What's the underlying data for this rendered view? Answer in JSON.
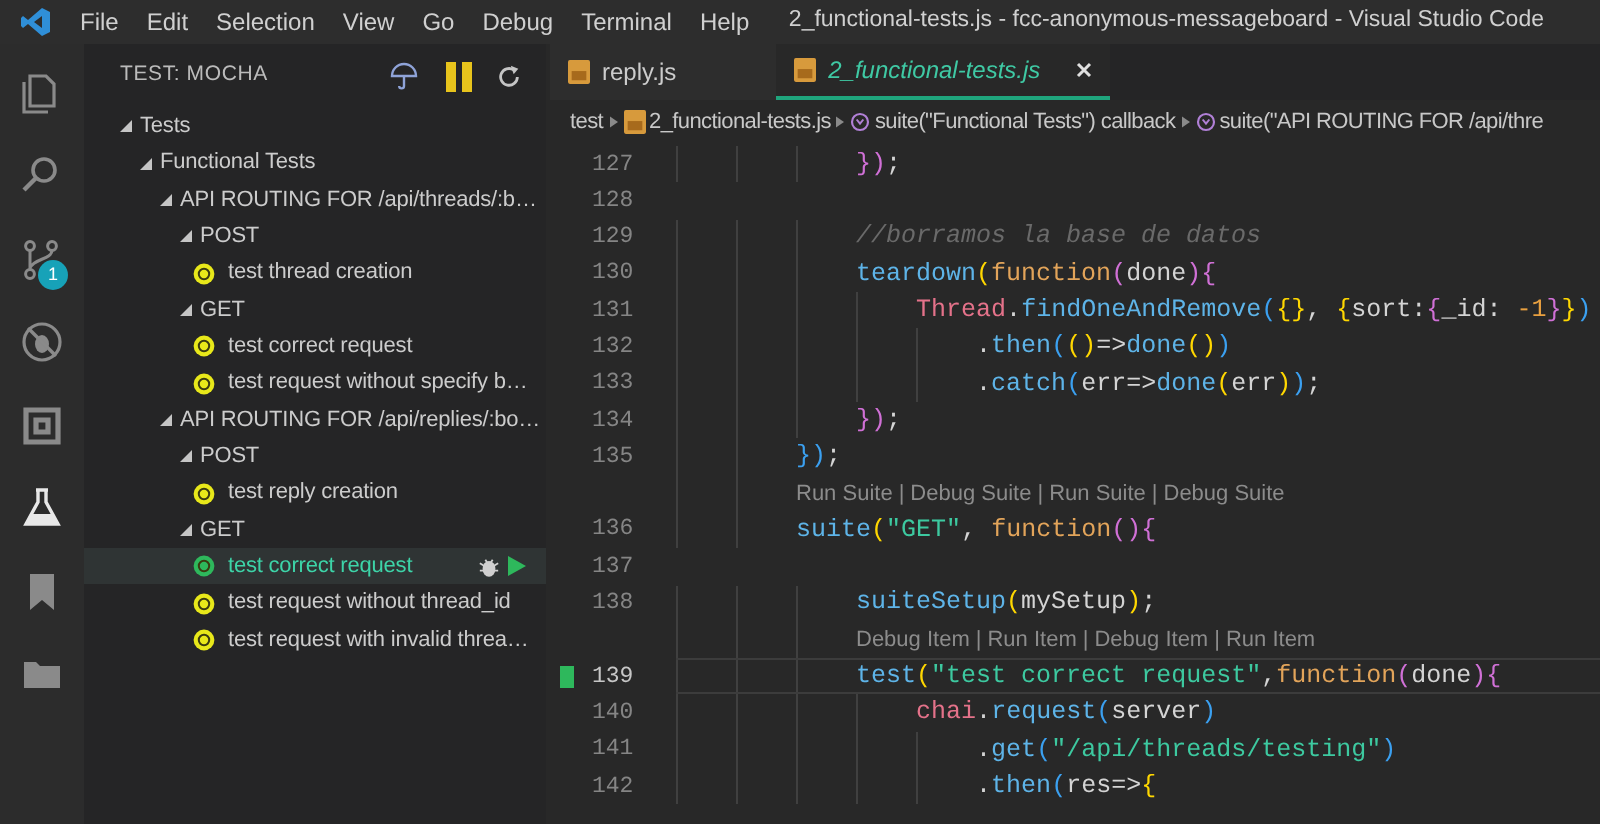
{
  "title_bar": {
    "menu": [
      "File",
      "Edit",
      "Selection",
      "View",
      "Go",
      "Debug",
      "Terminal",
      "Help"
    ],
    "title": "2_functional-tests.js - fcc-anonymous-messageboard - Visual Studio Code"
  },
  "activity_bar": [
    {
      "kind": "files",
      "selected": false
    },
    {
      "kind": "search",
      "selected": false
    },
    {
      "kind": "source-control",
      "selected": false,
      "badge": "1"
    },
    {
      "kind": "debug",
      "selected": false
    },
    {
      "kind": "extensions",
      "selected": false
    },
    {
      "kind": "test",
      "selected": true
    },
    {
      "kind": "bookmark",
      "selected": false
    },
    {
      "kind": "folder",
      "selected": false
    }
  ],
  "sidebar": {
    "title": "TEST: MOCHA",
    "tree": [
      {
        "kind": "suite",
        "label": "Tests",
        "expanded": true,
        "children": [
          {
            "kind": "suite",
            "label": "Functional Tests",
            "expanded": true,
            "children": [
              {
                "kind": "suite",
                "label": "API ROUTING FOR /api/threads/:b…",
                "expanded": true,
                "children": [
                  {
                    "kind": "suite",
                    "label": "POST",
                    "expanded": true,
                    "children": [
                      {
                        "kind": "pending",
                        "label": "test thread creation",
                        "selected": false
                      }
                    ]
                  },
                  {
                    "kind": "suite",
                    "label": "GET",
                    "expanded": true,
                    "children": [
                      {
                        "kind": "pending",
                        "label": "test correct request",
                        "selected": false
                      },
                      {
                        "kind": "pending",
                        "label": "test request without specify b…",
                        "selected": false
                      }
                    ]
                  }
                ]
              },
              {
                "kind": "suite",
                "label": "API ROUTING FOR /api/replies/:bo…",
                "expanded": true,
                "children": [
                  {
                    "kind": "suite",
                    "label": "POST",
                    "expanded": true,
                    "children": [
                      {
                        "kind": "pending",
                        "label": "test reply creation",
                        "selected": false
                      }
                    ]
                  },
                  {
                    "kind": "suite",
                    "label": "GET",
                    "expanded": true,
                    "children": [
                      {
                        "kind": "passed",
                        "label": "test correct request",
                        "selected": true
                      },
                      {
                        "kind": "pending",
                        "label": "test request without thread_id",
                        "selected": false
                      },
                      {
                        "kind": "pending",
                        "label": "test request with invalid threa…",
                        "selected": false
                      }
                    ]
                  }
                ]
              }
            ]
          }
        ]
      }
    ]
  },
  "tabs": [
    {
      "label": "reply.js",
      "selected": false
    },
    {
      "label": "2_functional-tests.js",
      "selected": true
    }
  ],
  "breadcrumb": [
    {
      "kind": "folder",
      "label": "test"
    },
    {
      "kind": "file",
      "label": "2_functional-tests.js"
    },
    {
      "kind": "symbol",
      "label": "suite(\"Functional Tests\") callback"
    },
    {
      "kind": "symbol",
      "label": "suite(\"API ROUTING FOR /api/thre"
    }
  ],
  "editor": {
    "lines": [
      {
        "kind": "code",
        "number": "127",
        "current": false,
        "passed": false,
        "tokens": [
          {
            "kind": "br2",
            "t": "            })"
          },
          {
            "kind": "txt",
            "t": ";"
          }
        ]
      },
      {
        "kind": "code",
        "number": "128",
        "current": false,
        "passed": false
      },
      {
        "kind": "code",
        "number": "129",
        "current": false,
        "passed": false,
        "tokens": [
          {
            "kind": "cmt",
            "t": "            //borramos la base de datos"
          }
        ]
      },
      {
        "kind": "code",
        "number": "130",
        "current": false,
        "passed": false,
        "tokens": [
          {
            "kind": "fn",
            "t": "            teardown"
          },
          {
            "kind": "br1",
            "t": "("
          },
          {
            "kind": "kw",
            "t": "function"
          },
          {
            "kind": "br2",
            "t": "("
          },
          {
            "kind": "txt",
            "t": "done"
          },
          {
            "kind": "br2",
            "t": "){"
          }
        ]
      },
      {
        "kind": "code",
        "number": "131",
        "current": false,
        "passed": false,
        "tokens": [
          {
            "kind": "var",
            "t": "                Thread"
          },
          {
            "kind": "txt",
            "t": "."
          },
          {
            "kind": "fn",
            "t": "findOneAndRemove"
          },
          {
            "kind": "br3",
            "t": "("
          },
          {
            "kind": "br1",
            "t": "{}"
          },
          {
            "kind": "txt",
            "t": ", "
          },
          {
            "kind": "br1",
            "t": "{"
          },
          {
            "kind": "txt",
            "t": "sort:"
          },
          {
            "kind": "br2",
            "t": "{"
          },
          {
            "kind": "txt",
            "t": "_id: "
          },
          {
            "kind": "num",
            "t": "-1"
          },
          {
            "kind": "br2",
            "t": "}"
          },
          {
            "kind": "br1",
            "t": "}"
          },
          {
            "kind": "br3",
            "t": ")"
          }
        ]
      },
      {
        "kind": "code",
        "number": "132",
        "current": false,
        "passed": false,
        "tokens": [
          {
            "kind": "txt",
            "t": "                    ."
          },
          {
            "kind": "fn",
            "t": "then"
          },
          {
            "kind": "br3",
            "t": "("
          },
          {
            "kind": "br1",
            "t": "()"
          },
          {
            "kind": "txt",
            "t": "=>"
          },
          {
            "kind": "fn",
            "t": "done"
          },
          {
            "kind": "br1",
            "t": "()"
          },
          {
            "kind": "br3",
            "t": ")"
          }
        ]
      },
      {
        "kind": "code",
        "number": "133",
        "current": false,
        "passed": false,
        "tokens": [
          {
            "kind": "txt",
            "t": "                    ."
          },
          {
            "kind": "fn",
            "t": "catch"
          },
          {
            "kind": "br3",
            "t": "("
          },
          {
            "kind": "txt",
            "t": "err=>"
          },
          {
            "kind": "fn",
            "t": "done"
          },
          {
            "kind": "br1",
            "t": "("
          },
          {
            "kind": "txt",
            "t": "err"
          },
          {
            "kind": "br1",
            "t": ")"
          },
          {
            "kind": "br3",
            "t": ")"
          },
          {
            "kind": "txt",
            "t": ";"
          }
        ]
      },
      {
        "kind": "code",
        "number": "134",
        "current": false,
        "passed": false,
        "tokens": [
          {
            "kind": "br2",
            "t": "            })"
          },
          {
            "kind": "txt",
            "t": ";"
          }
        ]
      },
      {
        "kind": "code",
        "number": "135",
        "current": false,
        "passed": false,
        "tokens": [
          {
            "kind": "br3",
            "t": "        })"
          },
          {
            "kind": "txt",
            "t": ";"
          }
        ]
      },
      {
        "kind": "codelens",
        "separator": "|",
        "links": [
          "Run Suite",
          "Debug Suite",
          "Run Suite",
          "Debug Suite"
        ]
      },
      {
        "kind": "code",
        "number": "136",
        "current": false,
        "passed": false,
        "tokens": [
          {
            "kind": "fn",
            "t": "        suite"
          },
          {
            "kind": "br1",
            "t": "("
          },
          {
            "kind": "str",
            "t": "\"GET\""
          },
          {
            "kind": "txt",
            "t": ", "
          },
          {
            "kind": "kw",
            "t": "function"
          },
          {
            "kind": "br2",
            "t": "(){"
          }
        ]
      },
      {
        "kind": "code",
        "number": "137",
        "current": false,
        "passed": false
      },
      {
        "kind": "code",
        "number": "138",
        "current": false,
        "passed": false,
        "tokens": [
          {
            "kind": "fn",
            "t": "            suiteSetup"
          },
          {
            "kind": "br1",
            "t": "("
          },
          {
            "kind": "txt",
            "t": "mySetup"
          },
          {
            "kind": "br1",
            "t": ")"
          },
          {
            "kind": "txt",
            "t": ";"
          }
        ]
      },
      {
        "kind": "codelens",
        "separator": "|",
        "links": [
          "Debug Item",
          "Run Item",
          "Debug Item",
          "Run Item"
        ]
      },
      {
        "kind": "code",
        "number": "139",
        "current": true,
        "passed": true,
        "tokens": [
          {
            "kind": "fn",
            "t": "            test"
          },
          {
            "kind": "br1",
            "t": "("
          },
          {
            "kind": "str",
            "t": "\"test correct request\""
          },
          {
            "kind": "txt",
            "t": ","
          },
          {
            "kind": "kw",
            "t": "function"
          },
          {
            "kind": "br2",
            "t": "("
          },
          {
            "kind": "txt",
            "t": "done"
          },
          {
            "kind": "br2",
            "t": "){"
          }
        ]
      },
      {
        "kind": "code",
        "number": "140",
        "current": false,
        "passed": false,
        "tokens": [
          {
            "kind": "var",
            "t": "                chai"
          },
          {
            "kind": "txt",
            "t": "."
          },
          {
            "kind": "fn",
            "t": "request"
          },
          {
            "kind": "br3",
            "t": "("
          },
          {
            "kind": "txt",
            "t": "server"
          },
          {
            "kind": "br3",
            "t": ")"
          }
        ]
      },
      {
        "kind": "code",
        "number": "141",
        "current": false,
        "passed": false,
        "tokens": [
          {
            "kind": "txt",
            "t": "                    ."
          },
          {
            "kind": "fn",
            "t": "get"
          },
          {
            "kind": "br3",
            "t": "("
          },
          {
            "kind": "str",
            "t": "\"/api/threads/testing\""
          },
          {
            "kind": "br3",
            "t": ")"
          }
        ]
      },
      {
        "kind": "code",
        "number": "142",
        "current": false,
        "passed": false,
        "tokens": [
          {
            "kind": "txt",
            "t": "                    ."
          },
          {
            "kind": "fn",
            "t": "then"
          },
          {
            "kind": "br3",
            "t": "("
          },
          {
            "kind": "txt",
            "t": "res=>"
          },
          {
            "kind": "br1",
            "t": "{"
          }
        ]
      }
    ]
  }
}
